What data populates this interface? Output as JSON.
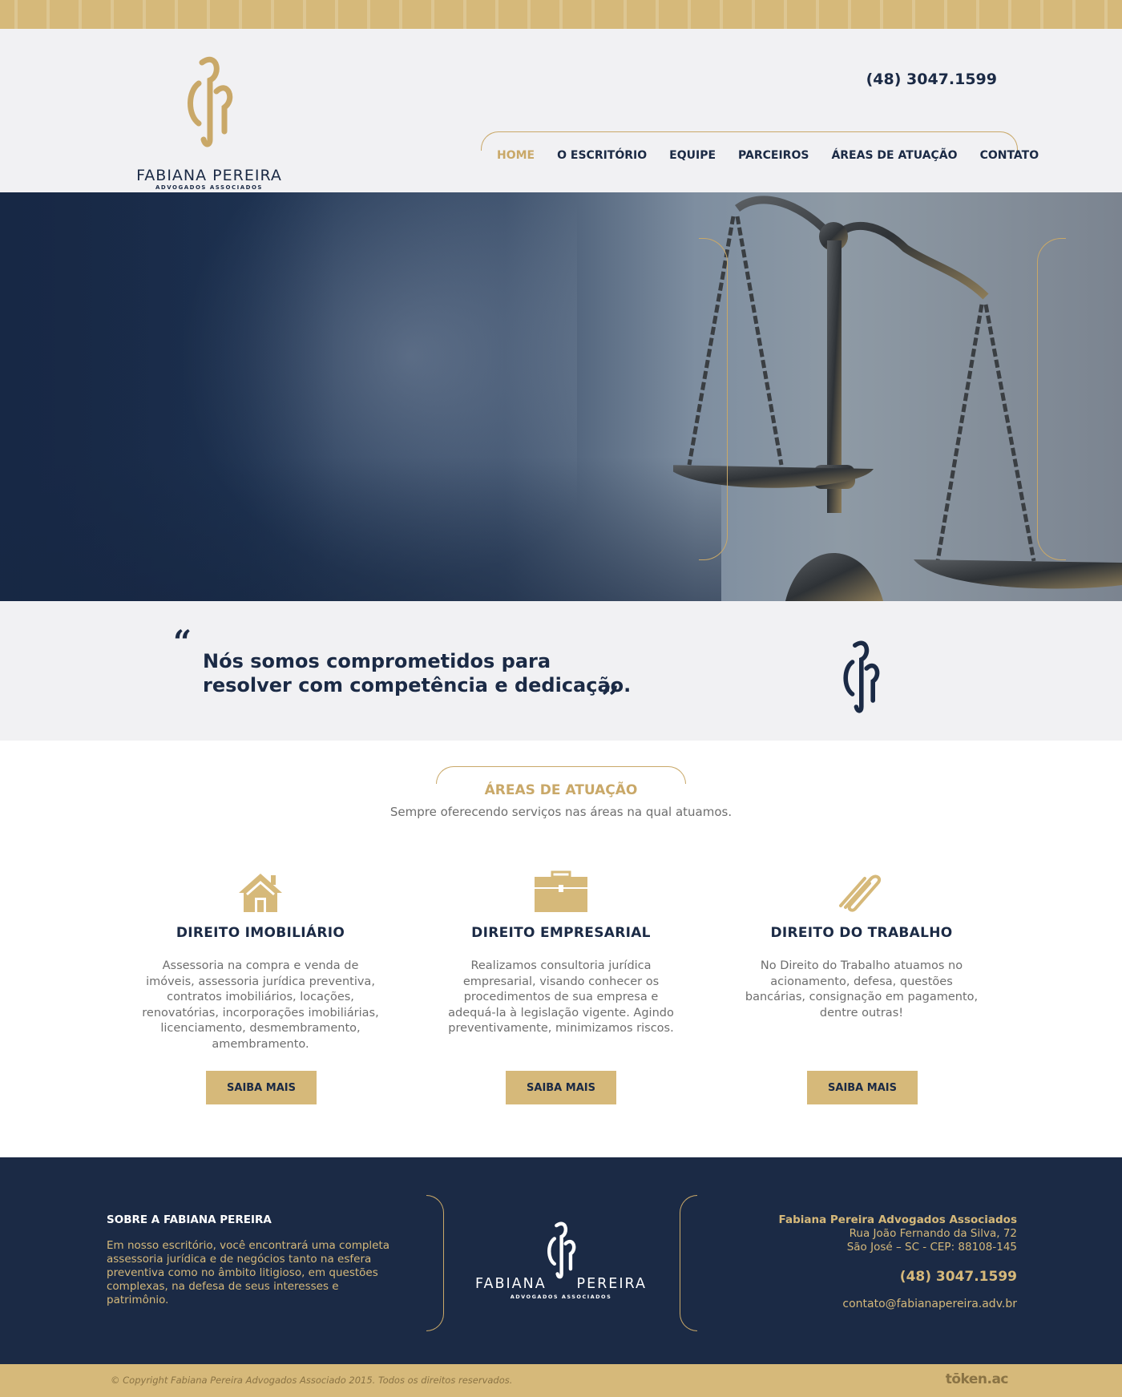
{
  "header": {
    "logo": {
      "name": "FABIANA PEREIRA",
      "sub": "ADVOGADOS ASSOCIADOS"
    },
    "phone": "(48) 3047.1599",
    "nav": [
      {
        "label": "HOME",
        "active": true
      },
      {
        "label": "O ESCRITÓRIO",
        "active": false
      },
      {
        "label": "EQUIPE",
        "active": false
      },
      {
        "label": "PARCEIROS",
        "active": false
      },
      {
        "label": "ÁREAS DE ATUAÇÃO",
        "active": false
      },
      {
        "label": "CONTATO",
        "active": false
      }
    ]
  },
  "hero": {
    "image": "scales-of-justice-photo"
  },
  "quote": {
    "open": "“",
    "close": "”",
    "line1": "Nós somos comprometidos para",
    "line2": "resolver com competência e dedicação."
  },
  "areas": {
    "title": "ÁREAS DE ATUAÇÃO",
    "subtitle": "Sempre oferecendo serviços nas áreas na qual atuamos.",
    "cards": [
      {
        "icon": "house-icon",
        "title": "DIREITO IMOBILIÁRIO",
        "text": "Assessoria na compra e venda de imóveis, assessoria jurídica preventiva, contratos imobiliários, locações, renovatórias, incorporações imobiliárias, licenciamento, desmembramento, amembramento.",
        "button": "SAIBA MAIS"
      },
      {
        "icon": "briefcase-icon",
        "title": "DIREITO EMPRESARIAL",
        "text": "Realizamos consultoria jurídica empresarial, visando conhecer os procedimentos de sua empresa e adequá-la à legislação vigente. Agindo preventivamente, minimizamos riscos.",
        "button": "SAIBA MAIS"
      },
      {
        "icon": "paperclip-icon",
        "title": "DIREITO DO TRABALHO",
        "text": "No Direito do Trabalho atuamos no acionamento, defesa, questões bancárias, consignação em pagamento, dentre outras!",
        "button": "SAIBA MAIS"
      }
    ]
  },
  "footer": {
    "about_title": "SOBRE A FABIANA PEREIRA",
    "about_text": "Em nosso escritório,  você encontrará uma completa assessoria jurídica e de negócios tanto na esfera preventiva como no âmbito litigioso, em questões complexas, na defesa de seus interesses e patrimônio.",
    "logo": {
      "left": "FABIANA",
      "right": "PEREIRA",
      "sub": "ADVOGADOS ASSOCIADOS"
    },
    "company": "Fabiana Pereira Advogados Associados",
    "address1": "Rua João Fernando da Silva, 72",
    "address2": "São José – SC - CEP: 88108-145",
    "phone": "(48) 3047.1599",
    "email": "contato@fabianapereira.adv.br"
  },
  "bottom": {
    "copyright": "© Copyright Fabiana Pereira Advogados Associado 2015. Todos os direitos reservados.",
    "credit": "tōken.ac"
  },
  "colors": {
    "gold": "#d6b97a",
    "navy": "#1b2a45",
    "light": "#f1f1f3"
  }
}
